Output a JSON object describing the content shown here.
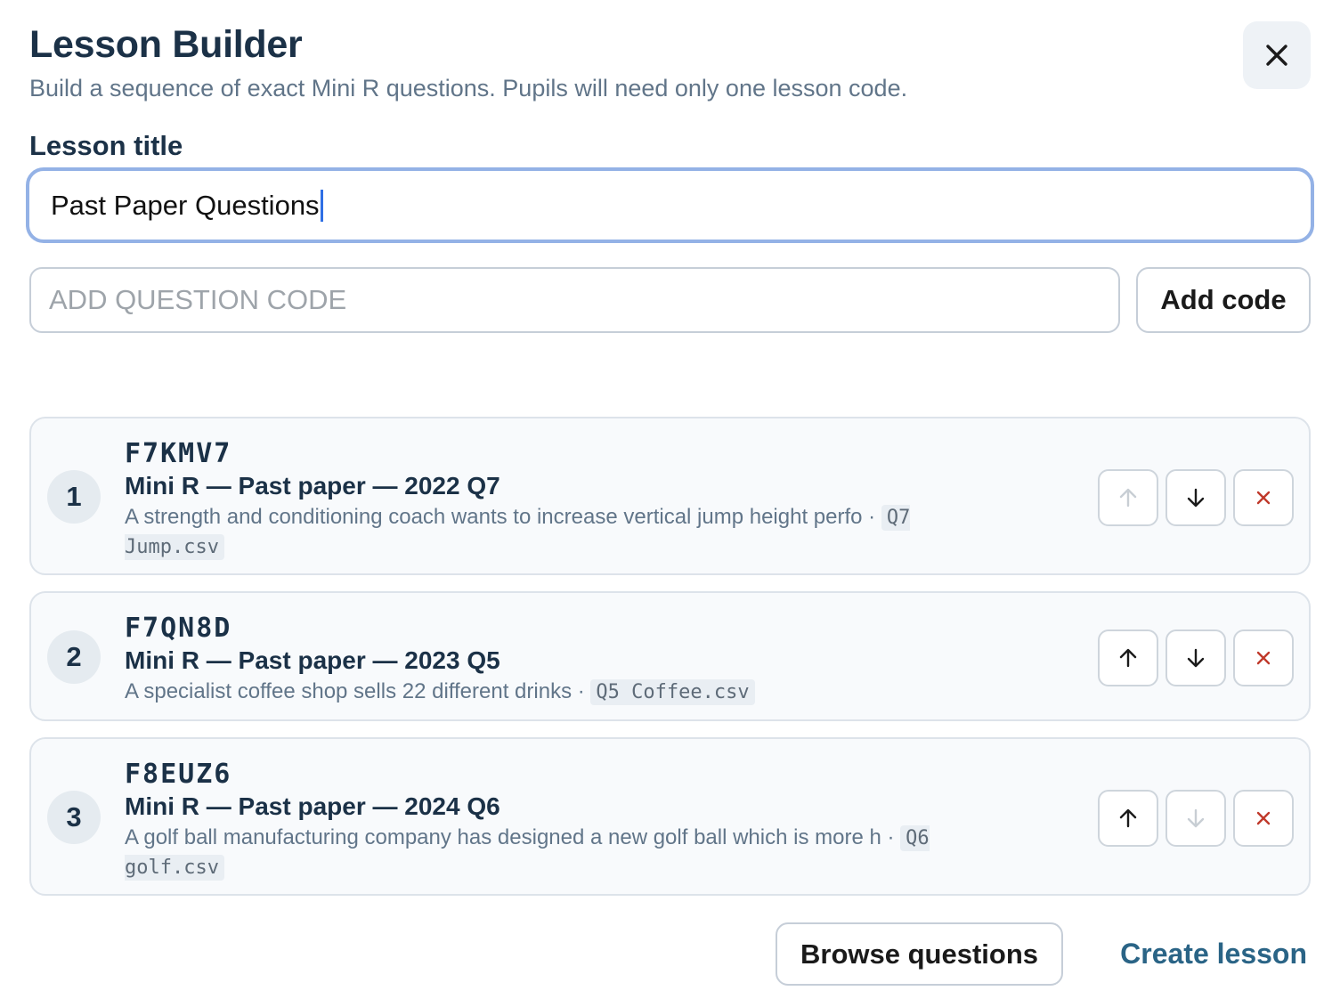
{
  "header": {
    "title": "Lesson Builder",
    "subtitle": "Build a sequence of exact Mini R questions. Pupils will need only one lesson code."
  },
  "form": {
    "title_label": "Lesson title",
    "title_value": "Past Paper Questions",
    "code_placeholder": "ADD QUESTION CODE",
    "add_code_label": "Add code"
  },
  "questions": [
    {
      "index": "1",
      "code": "F7KMV7",
      "name": "Mini R — Past paper — 2022 Q7",
      "description": "A strength and conditioning coach wants to increase vertical jump height perfo",
      "separator": " · ",
      "file": "Q7 Jump.csv",
      "up_enabled": false,
      "down_enabled": true
    },
    {
      "index": "2",
      "code": "F7QN8D",
      "name": "Mini R — Past paper — 2023 Q5",
      "description": "A specialist coffee shop sells 22 different drinks",
      "separator": " · ",
      "file": "Q5 Coffee.csv",
      "up_enabled": true,
      "down_enabled": true
    },
    {
      "index": "3",
      "code": "F8EUZ6",
      "name": "Mini R — Past paper — 2024 Q6",
      "description": "A golf ball manufacturing company has designed a new golf ball which is more h",
      "separator": " · ",
      "file": "Q6 golf.csv",
      "up_enabled": true,
      "down_enabled": false
    }
  ],
  "footer": {
    "browse_label": "Browse questions",
    "create_label": "Create lesson"
  },
  "icons": {
    "close": "close-icon",
    "up": "arrow-up-icon",
    "down": "arrow-down-icon",
    "remove": "remove-icon"
  },
  "colors": {
    "accent": "#2a6486",
    "focus_border": "#94b2e6",
    "remove": "#c0392b",
    "muted_text": "#617589",
    "heading": "#1b3147"
  }
}
